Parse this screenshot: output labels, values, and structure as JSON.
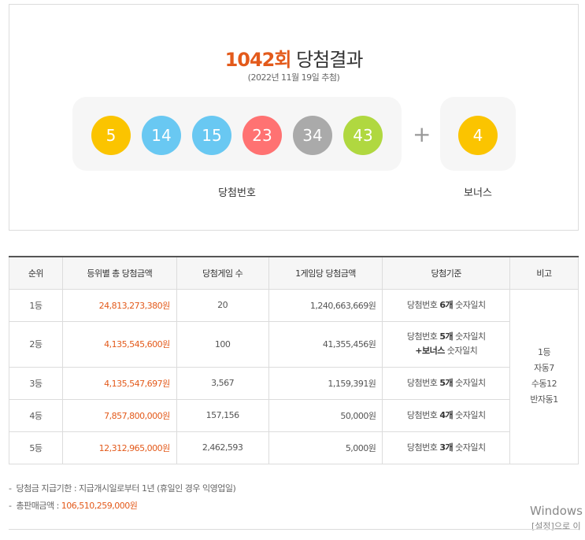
{
  "result": {
    "round": "1042회",
    "title_suffix": "당첨결과",
    "draw_date": "(2022년 11월 19일 추첨)",
    "numbers": [
      "5",
      "14",
      "15",
      "23",
      "34",
      "43"
    ],
    "number_colors": [
      "#fbc400",
      "#69c8f2",
      "#69c8f2",
      "#ff7272",
      "#aaaaaa",
      "#b0d840"
    ],
    "plus": "+",
    "bonus": "4",
    "bonus_color": "#fbc400",
    "numbers_caption": "당첨번호",
    "bonus_caption": "보너스"
  },
  "table": {
    "headers": [
      "순위",
      "등위별 총 당첨금액",
      "당첨게임 수",
      "1게임당 당첨금액",
      "당첨기준",
      "비고"
    ],
    "rows": [
      {
        "rank": "1등",
        "total": "24,813,273,380원",
        "winners": "20",
        "per_game": "1,240,663,669원",
        "crit_pre": "당첨번호 ",
        "crit_bold": "6개",
        "crit_post": " 숫자일치"
      },
      {
        "rank": "2등",
        "total": "4,135,545,600원",
        "winners": "100",
        "per_game": "41,355,456원",
        "crit_pre": "당첨번호 ",
        "crit_bold": "5개",
        "crit_post": " 숫자일치",
        "crit_line2_bold": "+보너스",
        "crit_line2_post": " 숫자일치"
      },
      {
        "rank": "3등",
        "total": "4,135,547,697원",
        "winners": "3,567",
        "per_game": "1,159,391원",
        "crit_pre": "당첨번호 ",
        "crit_bold": "5개",
        "crit_post": " 숫자일치"
      },
      {
        "rank": "4등",
        "total": "7,857,800,000원",
        "winners": "157,156",
        "per_game": "50,000원",
        "crit_pre": "당첨번호 ",
        "crit_bold": "4개",
        "crit_post": " 숫자일치"
      },
      {
        "rank": "5등",
        "total": "12,312,965,000원",
        "winners": "2,462,593",
        "per_game": "5,000원",
        "crit_pre": "당첨번호 ",
        "crit_bold": "3개",
        "crit_post": " 숫자일치"
      }
    ],
    "note_lines": [
      "1등",
      "자동7",
      "수동12",
      "반자동1"
    ]
  },
  "notes": {
    "deadline": "당첨금 지급기한 : 지급개시일로부터 1년 (휴일인 경우 익영업일)",
    "sales_label": "총판매금액 : ",
    "sales_value": "106,510,259,000원",
    "bullet": "-"
  },
  "watermark": {
    "line1": "Windows",
    "line2": "[설정]으로 이"
  }
}
